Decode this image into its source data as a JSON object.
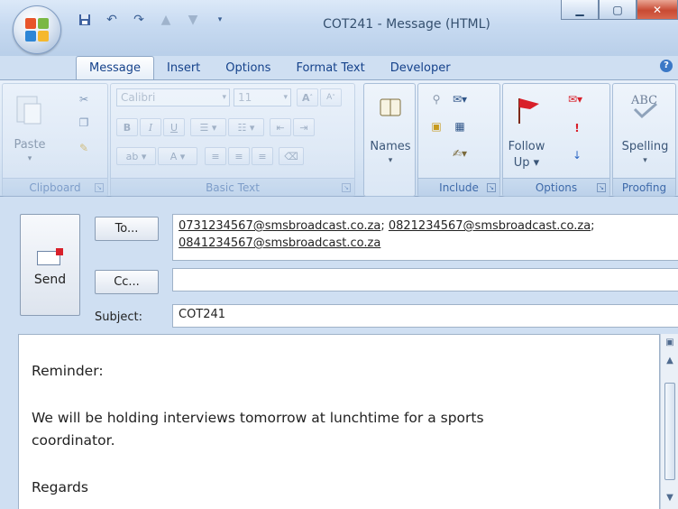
{
  "window": {
    "title": "COT241 - Message (HTML)"
  },
  "tabs": [
    "Message",
    "Insert",
    "Options",
    "Format Text",
    "Developer"
  ],
  "active_tab": "Message",
  "ribbon": {
    "clipboard": {
      "label": "Clipboard",
      "paste": "Paste"
    },
    "basic_text": {
      "label": "Basic Text",
      "font": "Calibri",
      "size": "11",
      "bold": "B",
      "italic": "I",
      "underline": "U",
      "grow": "A",
      "shrink": "A"
    },
    "names": {
      "label": "Names"
    },
    "include": {
      "label": "Include"
    },
    "options": {
      "label": "Options",
      "follow_up": "Follow",
      "follow_up2": "Up ▾"
    },
    "proofing": {
      "label": "Proofing",
      "spelling": "Spelling"
    }
  },
  "compose": {
    "send": "Send",
    "to_button": "To...",
    "cc_button": "Cc...",
    "subject_label": "Subject:",
    "to_recipients": [
      "0731234567@smsbroadcast.co.za",
      "0821234567@smsbroadcast.co.za",
      "0841234567@smsbroadcast.co.za"
    ],
    "cc_value": "",
    "subject_value": "COT241"
  },
  "body_lines": {
    "l1": "Reminder:",
    "l2": "We will be holding interviews tomorrow at lunchtime for a sports",
    "l3": "coordinator.",
    "l4": "Regards"
  },
  "colors": {
    "accent": "#15428b",
    "close": "#c84a33",
    "flag": "#d8202a"
  }
}
